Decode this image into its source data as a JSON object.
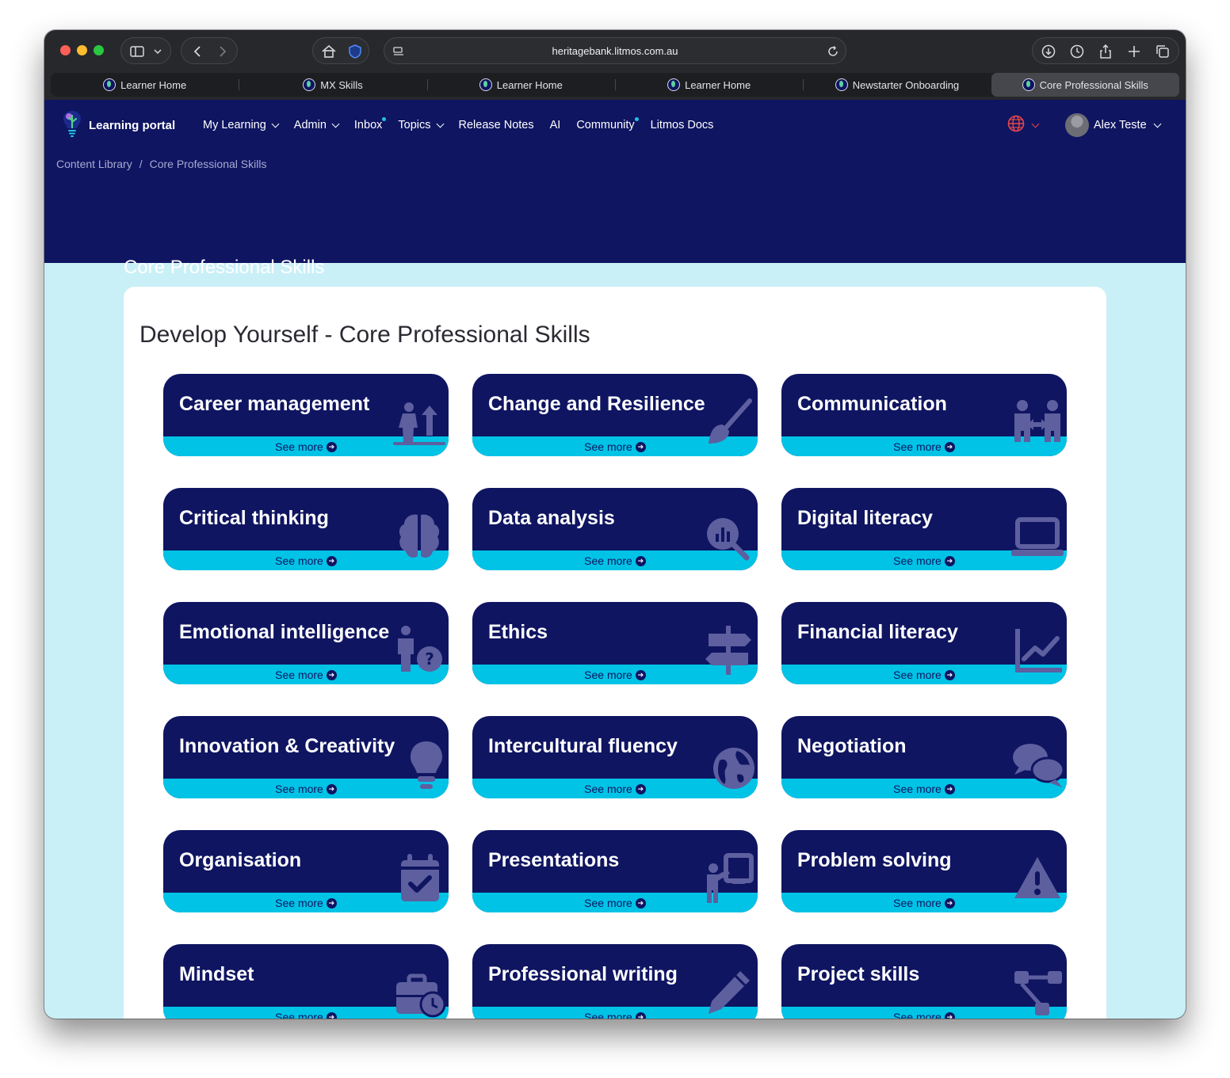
{
  "browser": {
    "url": "heritagebank.litmos.com.au",
    "tabs": [
      {
        "label": "Learner Home",
        "active": false
      },
      {
        "label": "MX Skills",
        "active": false
      },
      {
        "label": "Learner Home",
        "active": false
      },
      {
        "label": "Learner Home",
        "active": false
      },
      {
        "label": "Newstarter Onboarding",
        "active": false
      },
      {
        "label": "Core Professional Skills",
        "active": true
      }
    ]
  },
  "header": {
    "brand": "Learning portal",
    "nav": {
      "my_learning": "My Learning",
      "admin": "Admin",
      "inbox": "Inbox",
      "topics": "Topics",
      "release_notes": "Release Notes",
      "ai": "AI",
      "community": "Community",
      "litmos_docs": "Litmos Docs"
    },
    "user_name": "Alex Teste"
  },
  "breadcrumb": {
    "root": "Content Library",
    "separator": "/",
    "current": "Core Professional Skills"
  },
  "page_title": "Core Professional Skills",
  "section_title": "Develop Yourself - Core Professional Skills",
  "see_more_label": "See more",
  "tiles": [
    {
      "title": "Career management",
      "icon": "person-arrow-up-icon"
    },
    {
      "title": "Change and Resilience",
      "icon": "brush-icon"
    },
    {
      "title": "Communication",
      "icon": "people-arrows-icon"
    },
    {
      "title": "Critical thinking",
      "icon": "brain-icon"
    },
    {
      "title": "Data analysis",
      "icon": "magnifying-chart-icon"
    },
    {
      "title": "Digital literacy",
      "icon": "laptop-icon"
    },
    {
      "title": "Emotional intelligence",
      "icon": "person-question-icon"
    },
    {
      "title": "Ethics",
      "icon": "signpost-icon"
    },
    {
      "title": "Financial literacy",
      "icon": "chart-line-icon"
    },
    {
      "title": "Innovation & Creativity",
      "icon": "lightbulb-icon"
    },
    {
      "title": "Intercultural fluency",
      "icon": "globe-icon"
    },
    {
      "title": "Negotiation",
      "icon": "comments-icon"
    },
    {
      "title": "Organisation",
      "icon": "calendar-check-icon"
    },
    {
      "title": "Presentations",
      "icon": "person-chalkboard-icon"
    },
    {
      "title": "Problem solving",
      "icon": "warning-triangle-icon"
    },
    {
      "title": "Mindset",
      "icon": "briefcase-clock-icon"
    },
    {
      "title": "Professional writing",
      "icon": "pen-icon"
    },
    {
      "title": "Project skills",
      "icon": "diagram-icon"
    }
  ],
  "colors": {
    "navy": "#0f1561",
    "cyan": "#00c3e6",
    "page_bg": "#caf0f7",
    "icon": "#5d5f9f"
  }
}
